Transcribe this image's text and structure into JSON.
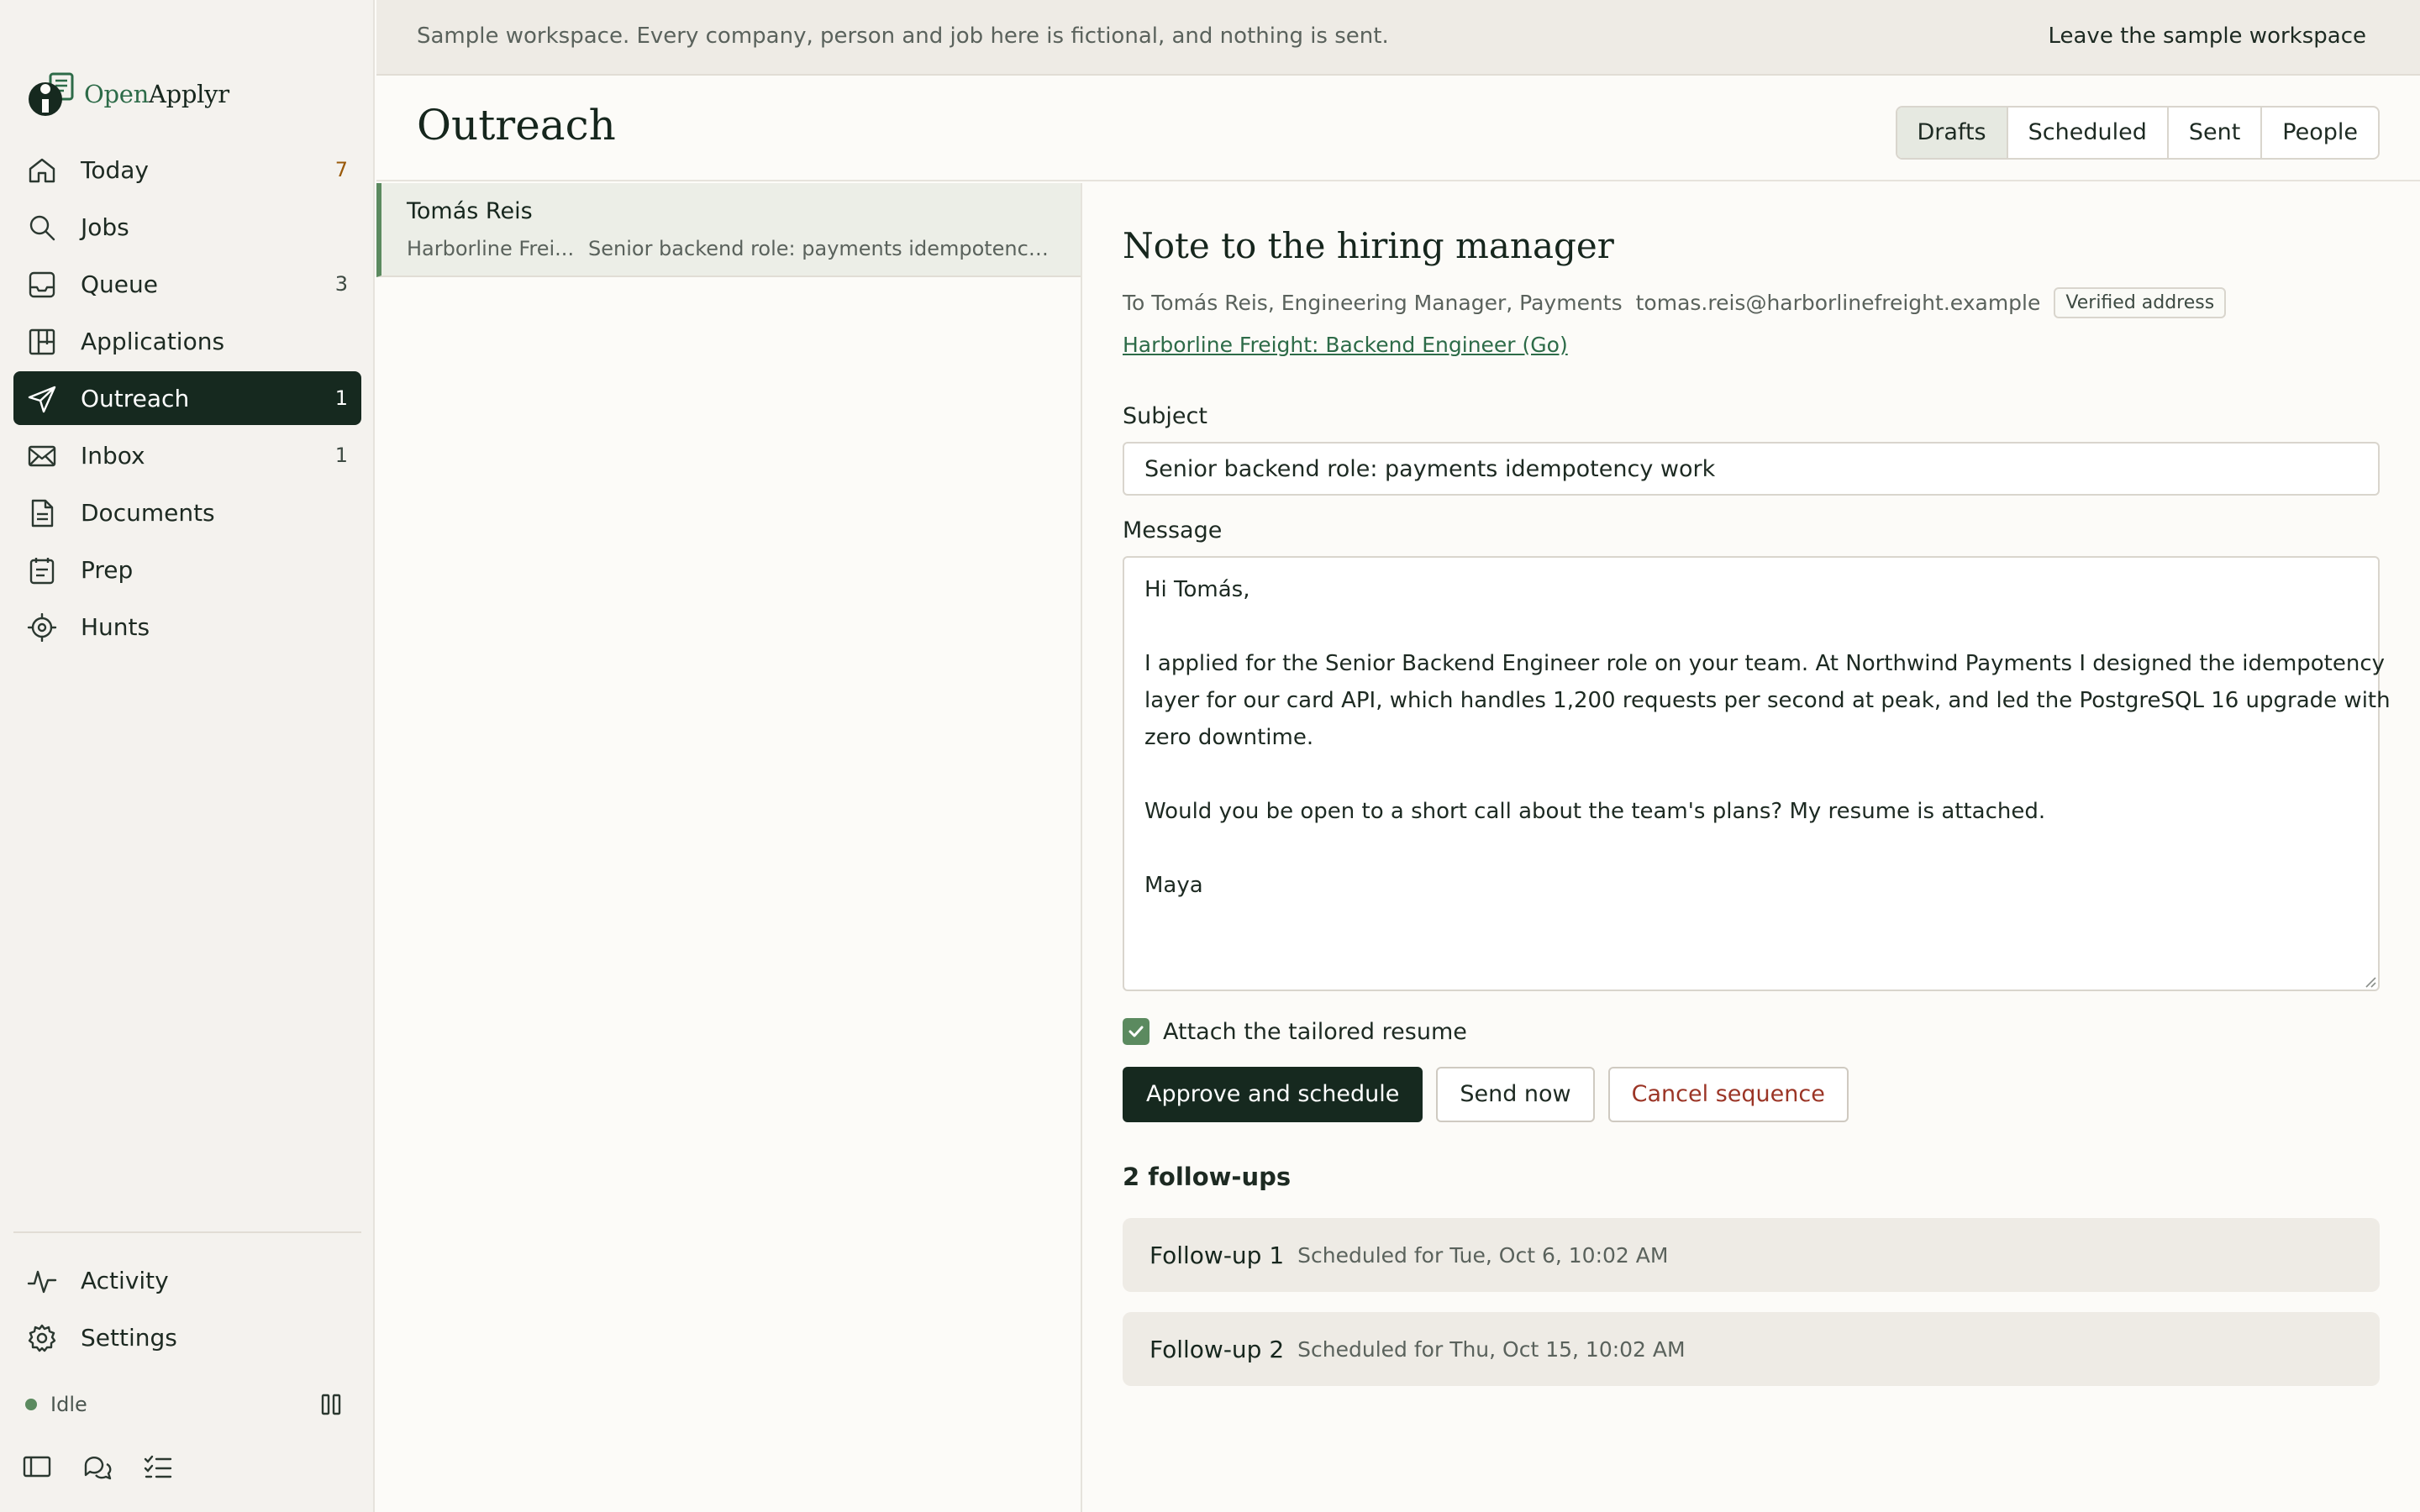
{
  "app": {
    "brand_prefix": "Open",
    "brand_suffix": "Applyr"
  },
  "colors": {
    "accent": "#16291f",
    "brand_green": "#2d6b48",
    "status_idle": "#5b8a5f",
    "danger": "#9b3526"
  },
  "sidebar": {
    "items": [
      {
        "label": "Today",
        "count": "7",
        "icon": "home-icon"
      },
      {
        "label": "Jobs",
        "count": "",
        "icon": "search-icon"
      },
      {
        "label": "Queue",
        "count": "3",
        "icon": "inbox-tray-icon"
      },
      {
        "label": "Applications",
        "count": "",
        "icon": "kanban-icon"
      },
      {
        "label": "Outreach",
        "count": "1",
        "icon": "send-icon",
        "active": true
      },
      {
        "label": "Inbox",
        "count": "1",
        "icon": "mail-icon"
      },
      {
        "label": "Documents",
        "count": "",
        "icon": "document-icon"
      },
      {
        "label": "Prep",
        "count": "",
        "icon": "clipboard-icon"
      },
      {
        "label": "Hunts",
        "count": "",
        "icon": "target-icon"
      }
    ],
    "bottom_items": [
      {
        "label": "Activity",
        "icon": "activity-icon"
      },
      {
        "label": "Settings",
        "icon": "gear-icon"
      }
    ],
    "status": {
      "label": "Idle"
    }
  },
  "banner": {
    "text": "Sample workspace. Every company, person and job here is fictional, and nothing is sent.",
    "leave": "Leave the sample workspace"
  },
  "header": {
    "title": "Outreach",
    "tabs": [
      {
        "label": "Drafts",
        "active": true
      },
      {
        "label": "Scheduled"
      },
      {
        "label": "Sent"
      },
      {
        "label": "People"
      }
    ]
  },
  "list": {
    "items": [
      {
        "name": "Tomás Reis",
        "company": "Harborline Frei...",
        "subject": "Senior backend role: payments idempotency ..."
      }
    ]
  },
  "detail": {
    "title": "Note to the hiring manager",
    "recipient": "To Tomás Reis, Engineering Manager, Payments",
    "email": "tomas.reis@harborlinefreight.example",
    "verified": "Verified address",
    "job_link": "Harborline Freight: Backend Engineer (Go)",
    "subject_label": "Subject",
    "subject_value": "Senior backend role: payments idempotency work",
    "message_label": "Message",
    "message_lines": [
      "Hi Tomás,",
      "",
      "I applied for the Senior Backend Engineer role on your team. At Northwind Payments I designed the idempotency",
      "layer for our card API, which handles 1,200 requests per second at peak, and led the PostgreSQL 16 upgrade with",
      "zero downtime.",
      "",
      "Would you be open to a short call about the team's plans? My resume is attached.",
      "",
      "Maya"
    ],
    "attach_label": "Attach the tailored resume",
    "attach_checked": true,
    "buttons": {
      "approve": "Approve and schedule",
      "send": "Send now",
      "cancel": "Cancel sequence"
    },
    "followups_title": "2 follow-ups",
    "followups": [
      {
        "name": "Follow-up 1",
        "schedule": "Scheduled for Tue, Oct 6, 10:02 AM"
      },
      {
        "name": "Follow-up 2",
        "schedule": "Scheduled for Thu, Oct 15, 10:02 AM"
      }
    ]
  }
}
